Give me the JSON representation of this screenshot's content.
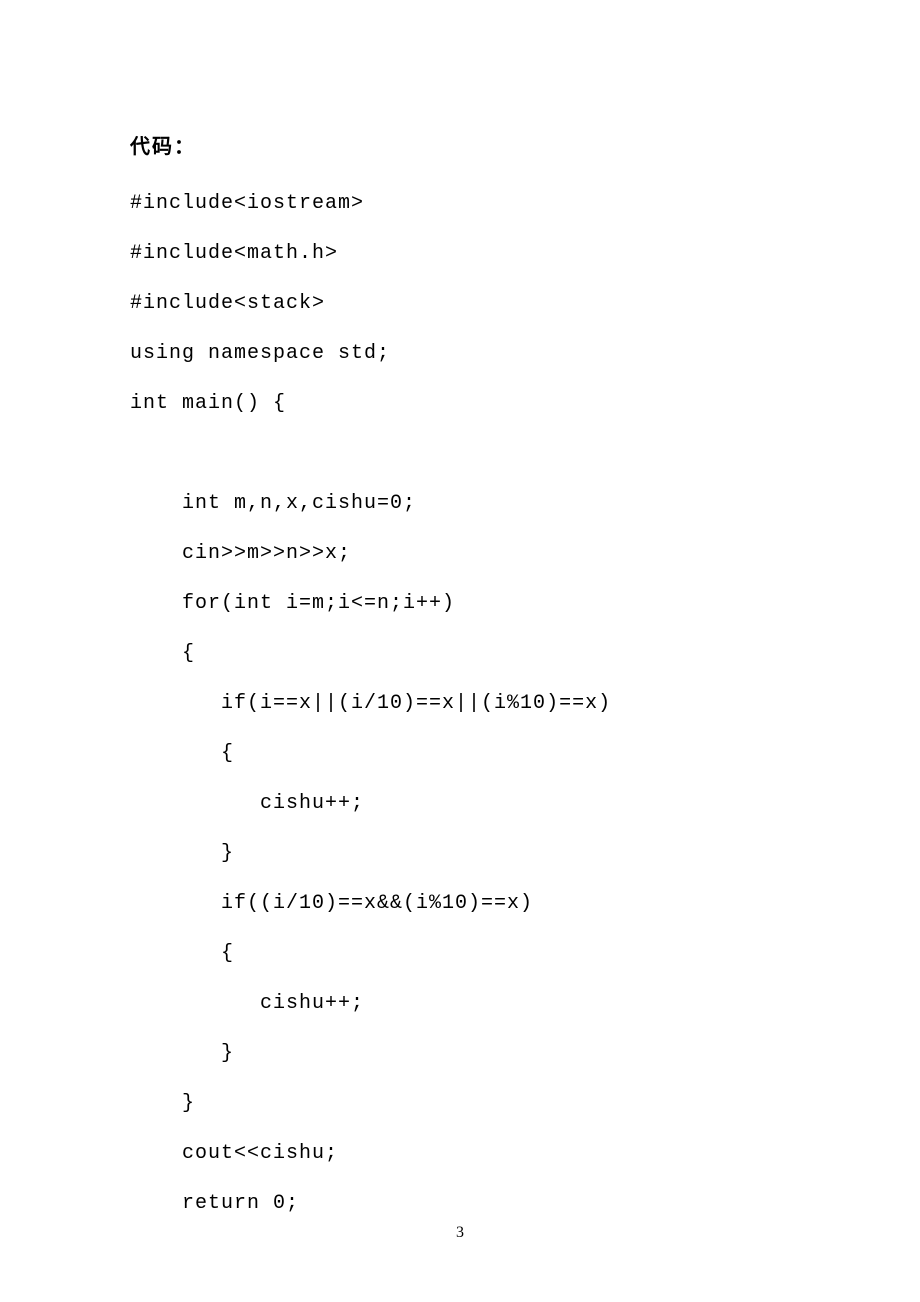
{
  "heading": "代码：",
  "code_lines": [
    "#include<iostream>",
    "#include<math.h>",
    "#include<stack>",
    "using namespace std;",
    "int main() {",
    "",
    "    int m,n,x,cishu=0;",
    "    cin>>m>>n>>x;",
    "    for(int i=m;i<=n;i++)",
    "    {",
    "       if(i==x||(i/10)==x||(i%10)==x)",
    "       {",
    "          cishu++;",
    "       }",
    "       if((i/10)==x&&(i%10)==x)",
    "       {",
    "          cishu++;",
    "       }",
    "    }",
    "    cout<<cishu;",
    "    return 0;"
  ],
  "page_number": "3"
}
